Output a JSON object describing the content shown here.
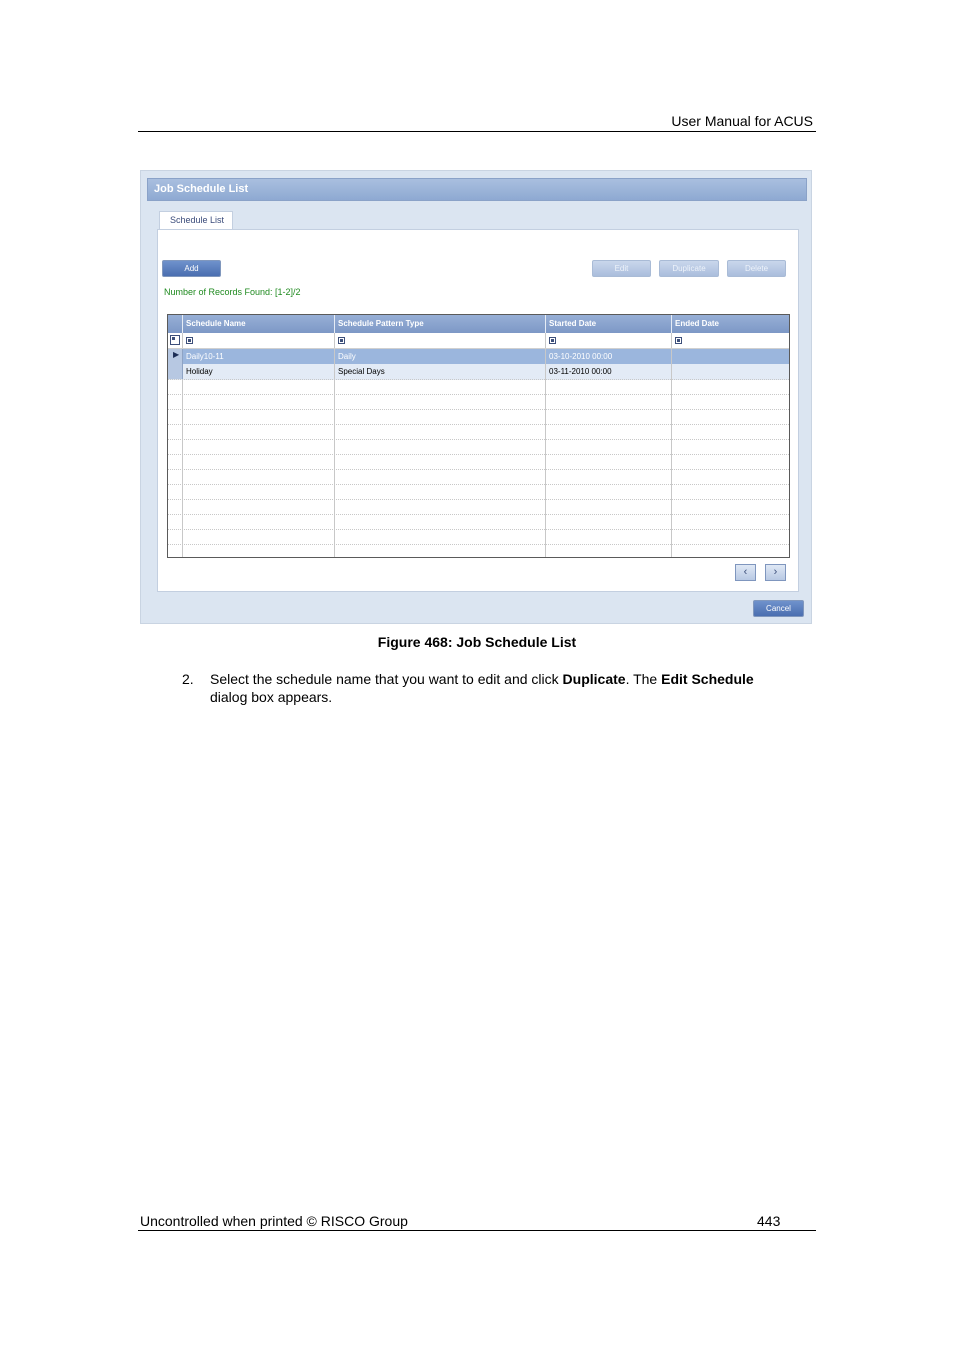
{
  "header": {
    "text": "User Manual for ACUS"
  },
  "screenshot": {
    "window_title": "Job Schedule List",
    "tab_label": "Schedule List",
    "buttons": {
      "add": "Add",
      "edit": "Edit",
      "duplicate": "Duplicate",
      "delete": "Delete",
      "cancel": "Cancel"
    },
    "records_found": "Number of Records Found: [1-2]/2",
    "columns": [
      "Schedule Name",
      "Schedule Pattern Type",
      "Started Date",
      "Ended Date"
    ],
    "rows": [
      {
        "name": "Daily10-11",
        "pattern": "Daily",
        "started": "03-10-2010 00:00",
        "ended": ""
      },
      {
        "name": "Holiday",
        "pattern": "Special Days",
        "started": "03-11-2010 00:00",
        "ended": ""
      }
    ],
    "colors": {
      "title_bar": "#8ea9d2",
      "selected_row": "#9bb6dd",
      "records_text": "#1f8a1f"
    }
  },
  "caption": "Figure 468: Job Schedule List",
  "step": {
    "number": "2.",
    "text_before": "Select the schedule name that you want to edit and click ",
    "bold1": "Duplicate",
    "text_middle": ". The ",
    "bold2": "Edit Schedule",
    "text_after": " dialog box appears."
  },
  "footer": {
    "left": "Uncontrolled when printed © RISCO Group",
    "page_number": "443"
  }
}
